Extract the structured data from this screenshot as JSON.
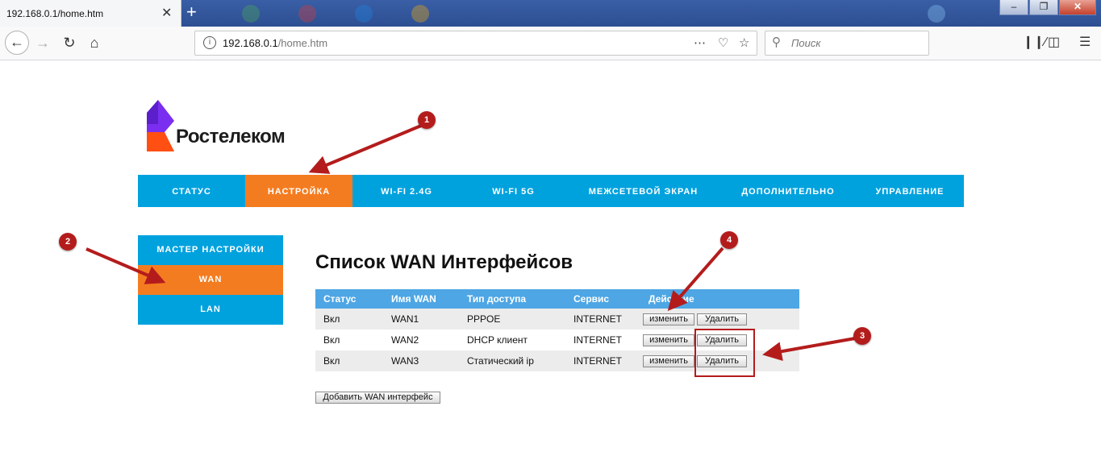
{
  "browser": {
    "tab_title": "192.168.0.1/home.htm",
    "tab_close": "✕",
    "new_tab": "+",
    "url_host": "192.168.0.1",
    "url_path": "/home.htm",
    "search_placeholder": "Поиск"
  },
  "brand": {
    "name": "Ростелеком"
  },
  "top_nav": [
    {
      "label": "СТАТУС",
      "active": false
    },
    {
      "label": "НАСТРОЙКА",
      "active": true
    },
    {
      "label": "WI-FI 2.4G",
      "active": false
    },
    {
      "label": "WI-FI 5G",
      "active": false
    },
    {
      "label": "МЕЖСЕТЕВОЙ ЭКРАН",
      "active": false
    },
    {
      "label": "ДОПОЛНИТЕЛЬНО",
      "active": false
    },
    {
      "label": "УПРАВЛЕНИЕ",
      "active": false
    }
  ],
  "side_nav": [
    {
      "label": "МАСТЕР НАСТРОЙКИ",
      "active": false
    },
    {
      "label": "WAN",
      "active": true
    },
    {
      "label": "LAN",
      "active": false
    }
  ],
  "page": {
    "heading": "Список WAN Интерфейсов",
    "columns": [
      "Статус",
      "Имя WAN",
      "Тип доступа",
      "Сервис",
      "Действие"
    ],
    "rows": [
      {
        "status": "Вкл",
        "name": "WAN1",
        "access": "PPPOE",
        "service": "INTERNET"
      },
      {
        "status": "Вкл",
        "name": "WAN2",
        "access": "DHCP клиент",
        "service": "INTERNET"
      },
      {
        "status": "Вкл",
        "name": "WAN3",
        "access": "Статический ip",
        "service": "INTERNET"
      }
    ],
    "edit_label": "изменить",
    "delete_label": "Удалить",
    "add_button": "Добавить WAN интерфейс"
  },
  "annotations": [
    "1",
    "2",
    "3",
    "4"
  ],
  "colors": {
    "brand_blue": "#00a2de",
    "brand_orange": "#f47c20",
    "table_header": "#4ea6e4",
    "annotation": "#b41c1c"
  }
}
